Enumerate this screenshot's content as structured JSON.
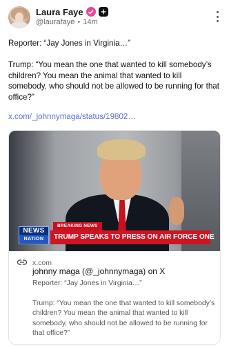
{
  "header": {
    "display_name": "Laura Faye",
    "handle": "@laurafaye",
    "separator": "•",
    "time_ago": "14m"
  },
  "post": {
    "paragraph_1": "Reporter: “Jay Jones in Virginia…”",
    "paragraph_2": "Trump: “You mean the one that wanted to kill somebody’s children? You mean the animal that wanted to kill somebody, who should not be allowed to be running for that office?”",
    "link_text": "x.com/_johnnymaga/status/19802…"
  },
  "card": {
    "overlay": {
      "breaking_label": "BREAKING NEWS",
      "logo_top": "NEWS",
      "logo_bottom": "NATION",
      "headline": "TRUMP SPEAKS TO PRESS ON AIR FORCE ONE"
    },
    "domain": "x.com",
    "title": "johnny maga (@_johnnymaga) on X",
    "description_1": "Reporter: “Jay Jones in Virginia…”",
    "description_2": "Trump: “You mean the one that wanted to kill somebody’s children? You mean the animal that wanted to kill somebody, who should not be allowed to be running for that office?”"
  },
  "icons": {
    "verified": "verified-badge-icon",
    "plus": "plus-badge-icon",
    "more": "more-vertical-icon",
    "link": "link-icon"
  },
  "colors": {
    "link": "#5b6fd6",
    "verified_badge": "#ec4899",
    "breaking_red": "#c8101e",
    "logo_blue": "#0b2f7a"
  }
}
